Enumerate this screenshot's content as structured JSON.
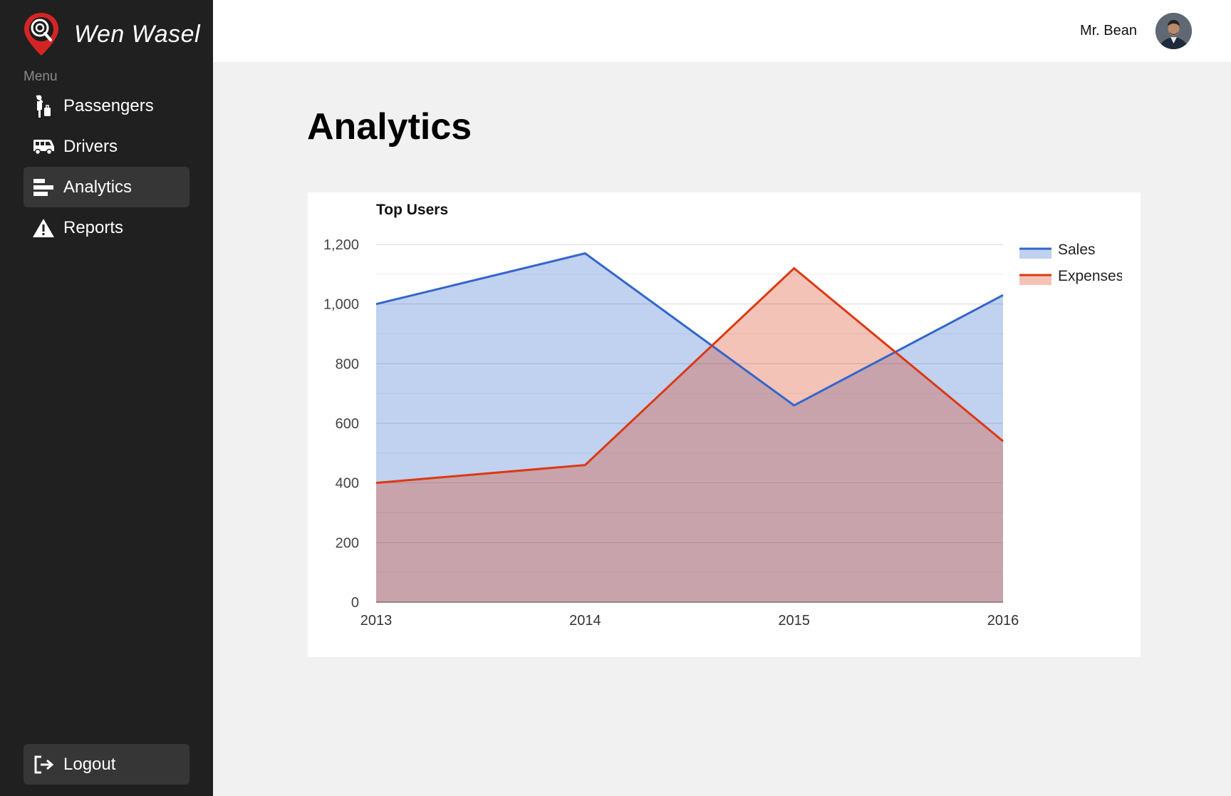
{
  "app": {
    "name": "Wen Wasel"
  },
  "sidebar": {
    "menu_caption": "Menu",
    "items": [
      {
        "label": "Passengers",
        "icon": "passenger-icon",
        "active": false
      },
      {
        "label": "Drivers",
        "icon": "van-icon",
        "active": false
      },
      {
        "label": "Analytics",
        "icon": "bar-chart-icon",
        "active": true
      },
      {
        "label": "Reports",
        "icon": "warning-icon",
        "active": false
      }
    ],
    "logout_label": "Logout"
  },
  "header": {
    "user_name": "Mr. Bean"
  },
  "page": {
    "title": "Analytics"
  },
  "chart_data": {
    "type": "area",
    "title": "Top Users",
    "x": [
      "2013",
      "2014",
      "2015",
      "2016"
    ],
    "series": [
      {
        "name": "Sales",
        "values": [
          1000,
          1170,
          660,
          1030
        ],
        "color": "#3366cc"
      },
      {
        "name": "Expenses",
        "values": [
          400,
          460,
          1120,
          540
        ],
        "color": "#dc3912"
      }
    ],
    "ylim": [
      0,
      1200
    ],
    "yticks": [
      "0",
      "200",
      "400",
      "600",
      "800",
      "1,000",
      "1,200"
    ],
    "grid": true,
    "legend": "right"
  }
}
